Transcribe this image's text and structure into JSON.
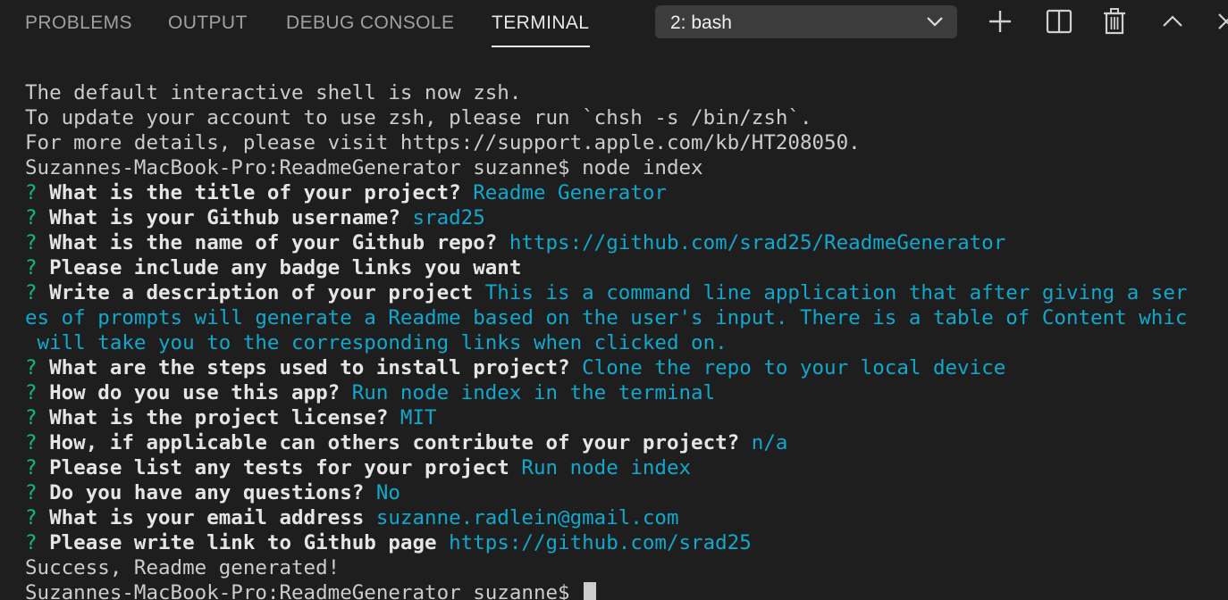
{
  "tabs": [
    {
      "label": "PROBLEMS",
      "active": false
    },
    {
      "label": "OUTPUT",
      "active": false
    },
    {
      "label": "DEBUG CONSOLE",
      "active": false
    },
    {
      "label": "TERMINAL",
      "active": true
    }
  ],
  "terminal_select": {
    "value": "2: bash"
  },
  "toolbar": {
    "icons": [
      "plus-icon",
      "split-icon",
      "trash-icon",
      "chevron-up-icon",
      "close-icon"
    ]
  },
  "colors": {
    "background": "#1e1e1e",
    "prompt_marker": "#0dbc79",
    "answer": "#11a8cd"
  },
  "terminal": {
    "intro": [
      "The default interactive shell is now zsh.",
      "To update your account to use zsh, please run `chsh -s /bin/zsh`.",
      "For more details, please visit https://support.apple.com/kb/HT208050.",
      "Suzannes-MacBook-Pro:ReadmeGenerator suzanne$ node index"
    ],
    "qa": [
      {
        "marker": "? ",
        "question": "What is the title of your project?",
        "answer": " Readme Generator"
      },
      {
        "marker": "? ",
        "question": "What is your Github username?",
        "answer": " srad25"
      },
      {
        "marker": "? ",
        "question": "What is the name of your Github repo?",
        "answer": " https://github.com/srad25/ReadmeGenerator"
      },
      {
        "marker": "? ",
        "question": "Please include any badge links you want",
        "answer": ""
      },
      {
        "marker": "? ",
        "question": "Write a description of your project",
        "answer": " This is a command line application that after giving a ser"
      }
    ],
    "wrap_lines": [
      "es of prompts will generate a Readme based on the user's input. There is a table of Content whic",
      " will take you to the corresponding links when clicked on."
    ],
    "qa2": [
      {
        "marker": "? ",
        "question": "What are the steps used to install project?",
        "answer": " Clone the repo to your local device"
      },
      {
        "marker": "? ",
        "question": "How do you use this app?",
        "answer": " Run node index in the terminal"
      },
      {
        "marker": "? ",
        "question": "What is the project license?",
        "answer": " MIT"
      },
      {
        "marker": "? ",
        "question": "How, if applicable can others contribute of your project?",
        "answer": " n/a"
      },
      {
        "marker": "? ",
        "question": "Please list any tests for your project",
        "answer": " Run node index"
      },
      {
        "marker": "? ",
        "question": "Do you have any questions?",
        "answer": " No"
      },
      {
        "marker": "? ",
        "question": "What is your email address",
        "answer": " suzanne.radlein@gmail.com"
      },
      {
        "marker": "? ",
        "question": "Please write link to Github page",
        "answer": " https://github.com/srad25"
      }
    ],
    "success": "Success, Readme generated!",
    "final_prompt": "Suzannes-MacBook-Pro:ReadmeGenerator suzanne$ "
  }
}
